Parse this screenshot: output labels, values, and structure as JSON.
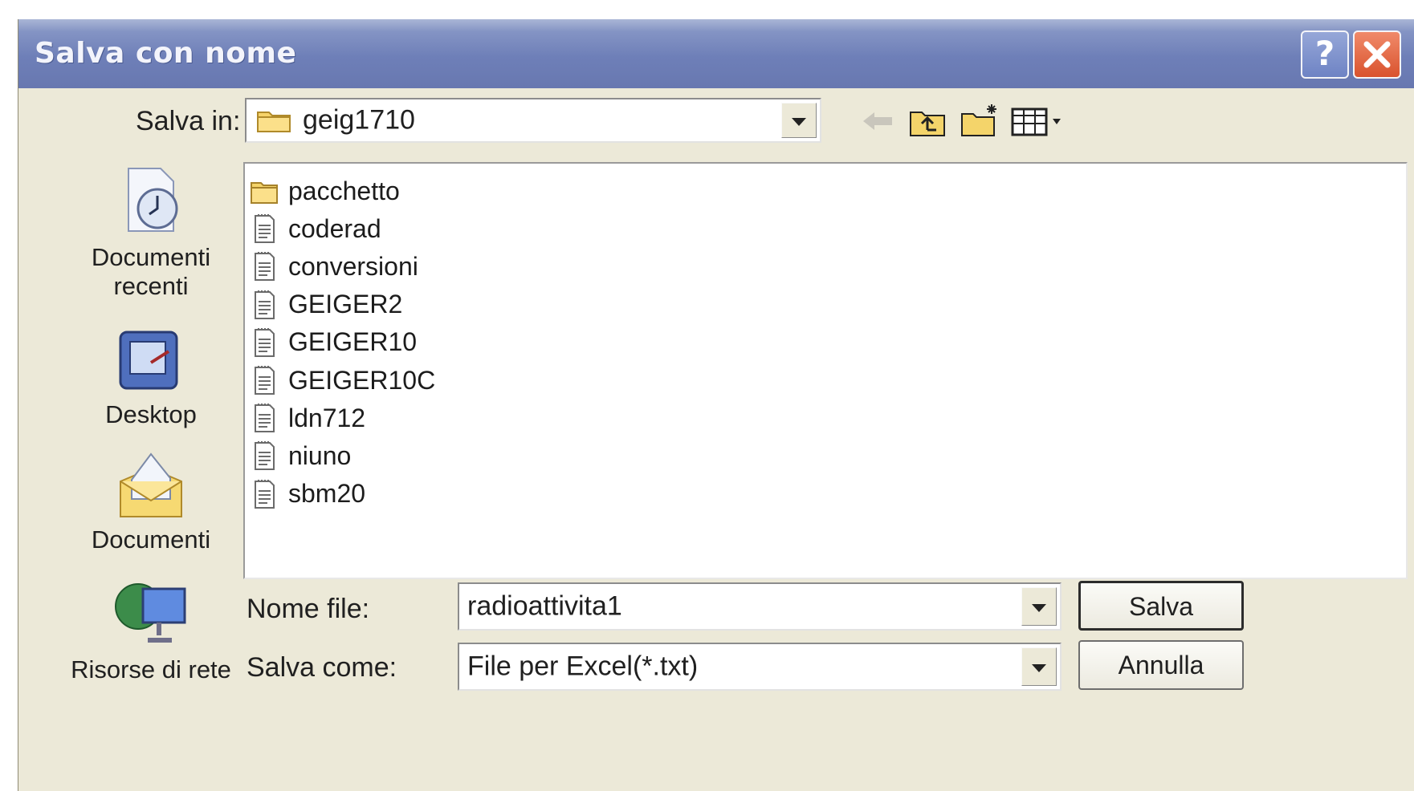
{
  "window": {
    "title": "Salva con nome",
    "help_label": "?",
    "close_label": "✕"
  },
  "toolbar": {
    "save_in_label": "Salva in:",
    "location": "geig1710",
    "icons": [
      "back-arrow-icon",
      "up-folder-icon",
      "new-folder-icon",
      "view-menu-icon"
    ]
  },
  "places_bar": {
    "items": [
      {
        "label_line1": "Documenti",
        "label_line2": "recenti",
        "icon": "recent-documents-icon"
      },
      {
        "label_line1": "Desktop",
        "label_line2": "",
        "icon": "desktop-icon"
      },
      {
        "label_line1": "Documenti",
        "label_line2": "",
        "icon": "my-documents-icon"
      },
      {
        "label_line1": "Risorse di rete",
        "label_line2": "",
        "icon": "network-places-icon"
      }
    ]
  },
  "files": [
    {
      "name": "pacchetto",
      "type": "folder"
    },
    {
      "name": "coderad",
      "type": "text"
    },
    {
      "name": "conversioni",
      "type": "text"
    },
    {
      "name": "GEIGER2",
      "type": "text"
    },
    {
      "name": "GEIGER10",
      "type": "text"
    },
    {
      "name": "GEIGER10C",
      "type": "text"
    },
    {
      "name": "ldn712",
      "type": "text"
    },
    {
      "name": "niuno",
      "type": "text"
    },
    {
      "name": "sbm20",
      "type": "text"
    }
  ],
  "form": {
    "filename_label": "Nome file:",
    "filename_value": "radioattivita1",
    "savetype_label": "Salva come:",
    "savetype_value": "File per Excel(*.txt)"
  },
  "buttons": {
    "save": "Salva",
    "cancel": "Annulla"
  }
}
